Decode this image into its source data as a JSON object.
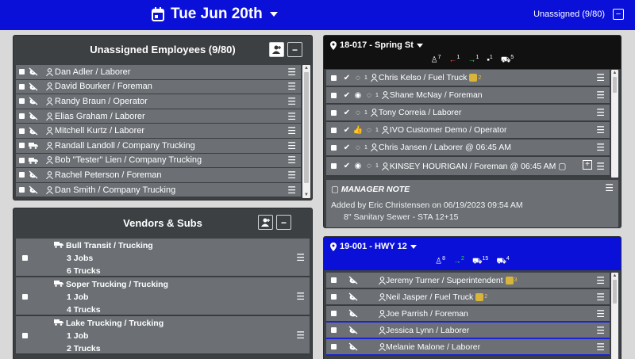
{
  "header": {
    "date": "Tue Jun 20th",
    "unassigned_label": "Unassigned (9/80)",
    "colors": {
      "bar": "#0a10d8"
    }
  },
  "employees": {
    "title": "Unassigned Employees (9/80)",
    "rows": [
      {
        "icon": "no-phone-icon",
        "label": "Dan Adler / Laborer"
      },
      {
        "icon": "no-phone-icon",
        "label": "David Bourker / Foreman"
      },
      {
        "icon": "no-phone-icon",
        "label": "Randy Braun / Operator"
      },
      {
        "icon": "no-phone-icon",
        "label": "Elias Graham / Laborer"
      },
      {
        "icon": "no-phone-icon",
        "label": "Mitchell Kurtz / Laborer"
      },
      {
        "icon": "truck-icon",
        "label": "Randall Landoll / Company Trucking"
      },
      {
        "icon": "truck-icon",
        "label": "Bob \"Tester\" Lien / Company Trucking"
      },
      {
        "icon": "no-phone-icon",
        "label": "Rachel Peterson / Foreman"
      },
      {
        "icon": "no-phone-icon",
        "label": "Dan Smith / Company Trucking"
      }
    ]
  },
  "vendors": {
    "title": "Vendors & Subs",
    "rows": [
      {
        "name": "Bull Transit / Trucking",
        "line1": "3 Jobs",
        "line2": "6 Trucks"
      },
      {
        "name": "Soper Trucking / Trucking",
        "line1": "1 Job",
        "line2": "4 Trucks"
      },
      {
        "name": "Lake Trucking / Trucking",
        "line1": "1 Job",
        "line2": "2 Trucks"
      }
    ]
  },
  "job1": {
    "title": "18-017 - Spring St",
    "stats": [
      "7",
      "1",
      "1",
      "1",
      "5"
    ],
    "rows": [
      {
        "label": "Chris Kelso / Fuel Truck",
        "c": "1",
        "b": "2"
      },
      {
        "label": "Shane McNay / Foreman",
        "c": "1",
        "b": ""
      },
      {
        "label": "Tony Correia / Laborer",
        "c": "1",
        "b": ""
      },
      {
        "label": "IVO Customer Demo / Operator",
        "c": "1",
        "b": ""
      },
      {
        "label": "Chris Jansen / Laborer @ 06:45 AM",
        "c": "1",
        "b": ""
      },
      {
        "label": "KINSEY HOURIGAN / Foreman @ 06:45 AM",
        "c": "1",
        "b": ""
      }
    ],
    "note": {
      "title": "MANAGER NOTE",
      "line1": "Added by Eric Christensen on 06/19/2023 09:54 AM",
      "line2": "8\" Sanitary Sewer - STA 12+15"
    }
  },
  "job2": {
    "title": "19-001 - HWY 12",
    "stats": [
      "8",
      "2",
      "15",
      "4"
    ],
    "rows": [
      {
        "label": "Jeremy Turner / Superintendent",
        "b": "3"
      },
      {
        "label": "Neil Jasper / Fuel Truck",
        "b": "2"
      },
      {
        "label": "Joe Parrish / Foreman",
        "b": ""
      },
      {
        "label": "Jessica Lynn / Laborer",
        "b": ""
      },
      {
        "label": "Melanie Malone / Laborer",
        "b": ""
      }
    ]
  }
}
